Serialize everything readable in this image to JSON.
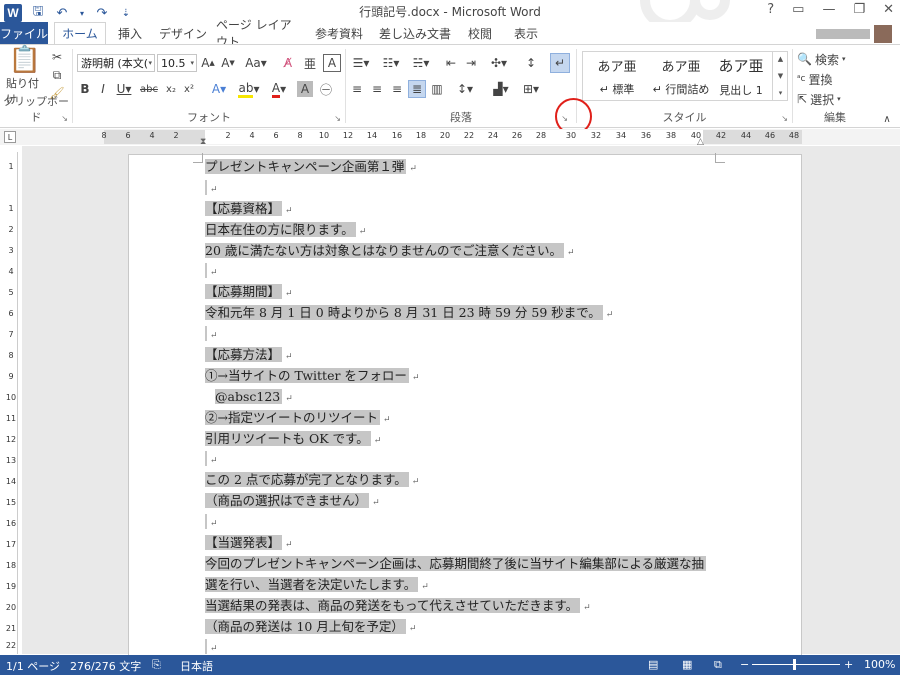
{
  "title_bar": {
    "title": "行頭記号.docx - Microsoft Word",
    "app_icon": "W",
    "controls": [
      "?",
      "▭",
      "—",
      "❐",
      "✕"
    ]
  },
  "quick_access": {
    "save_icon": "save-icon",
    "undo_icon": "undo-icon",
    "redo_icon": "redo-icon",
    "customize_icon": "customize-icon"
  },
  "tabs": {
    "file": "ファイル",
    "items": [
      "ホーム",
      "挿入",
      "デザイン",
      "ページ レイアウト",
      "参考資料",
      "差し込み文書",
      "校閲",
      "表示"
    ],
    "active": "ホーム"
  },
  "ribbon": {
    "clipboard": {
      "label": "クリップボード",
      "paste": "貼り付け"
    },
    "font": {
      "label": "フォント",
      "font_name": "游明朝 (本文(",
      "font_size": "10.5"
    },
    "paragraph": {
      "label": "段落"
    },
    "styles": {
      "label": "スタイル",
      "items": [
        {
          "sample": "あア亜",
          "name": "↵ 標準"
        },
        {
          "sample": "あア亜",
          "name": "↵ 行間詰め"
        },
        {
          "sample": "あア亜",
          "name": "見出し 1"
        }
      ]
    },
    "editing": {
      "label": "編集",
      "find": "検索",
      "replace": "置換",
      "select": "選択"
    }
  },
  "ruler": {
    "h_numbers": [
      "8",
      "6",
      "4",
      "2",
      "",
      "2",
      "4",
      "6",
      "8",
      "10",
      "12",
      "14",
      "16",
      "18",
      "20",
      "22",
      "24",
      "26",
      "28",
      "30",
      "32",
      "34",
      "36",
      "38",
      "40",
      "42",
      "44",
      "46",
      "48"
    ],
    "v_numbers": [
      "1",
      "",
      "1",
      "2",
      "3",
      "4",
      "5",
      "6",
      "7",
      "8",
      "9",
      "10",
      "11",
      "12",
      "13",
      "14",
      "15",
      "16",
      "17",
      "18",
      "19",
      "20",
      "21",
      "22",
      "23"
    ]
  },
  "document": {
    "lines": [
      {
        "text": "プレゼントキャンペーン企画第１弾",
        "mark": "↵"
      },
      {
        "text": "",
        "mark": "↵"
      },
      {
        "text": "【応募資格】",
        "mark": "↵"
      },
      {
        "text": "日本在住の方に限ります。",
        "mark": "↵"
      },
      {
        "text": "20 歳に満たない方は対象とはなりませんのでご注意ください。",
        "mark": "↵"
      },
      {
        "text": "",
        "mark": "↵"
      },
      {
        "text": "【応募期間】",
        "mark": "↵"
      },
      {
        "text": "令和元年 8 月 1 日 0 時よりから 8 月 31 日 23 時 59 分 59 秒まで。",
        "mark": "↵"
      },
      {
        "text": "",
        "mark": "↵"
      },
      {
        "text": "【応募方法】",
        "mark": "↵"
      },
      {
        "text": "①→当サイトの Twitter をフォロー",
        "mark": "↵"
      },
      {
        "text": "@absc123",
        "mark": "↵",
        "indent": true
      },
      {
        "text": "②→指定ツイートのリツイート",
        "mark": "↵"
      },
      {
        "text": "引用リツイートも OK です。",
        "mark": "↵"
      },
      {
        "text": "",
        "mark": "↵"
      },
      {
        "text": "この 2 点で応募が完了となります。",
        "mark": "↵"
      },
      {
        "text": "（商品の選択はできません）",
        "mark": "↵"
      },
      {
        "text": "",
        "mark": "↵"
      },
      {
        "text": "【当選発表】",
        "mark": "↵"
      },
      {
        "text": "今回のプレゼントキャンペーン企画は、応募期間終了後に当サイト編集部による厳選な抽",
        "mark": ""
      },
      {
        "text": "選を行い、当選者を決定いたします。",
        "mark": "↵"
      },
      {
        "text": "当選結果の発表は、商品の発送をもって代えさせていただきます。",
        "mark": "↵"
      },
      {
        "text": "（商品の発送は 10 月上旬を予定）",
        "mark": "↵"
      },
      {
        "text": "",
        "mark": "↵"
      }
    ]
  },
  "status_bar": {
    "page": "1/1 ページ",
    "words": "276/276 文字",
    "language": "日本語",
    "zoom": "100%",
    "zoom_minus": "−",
    "zoom_plus": "+"
  }
}
